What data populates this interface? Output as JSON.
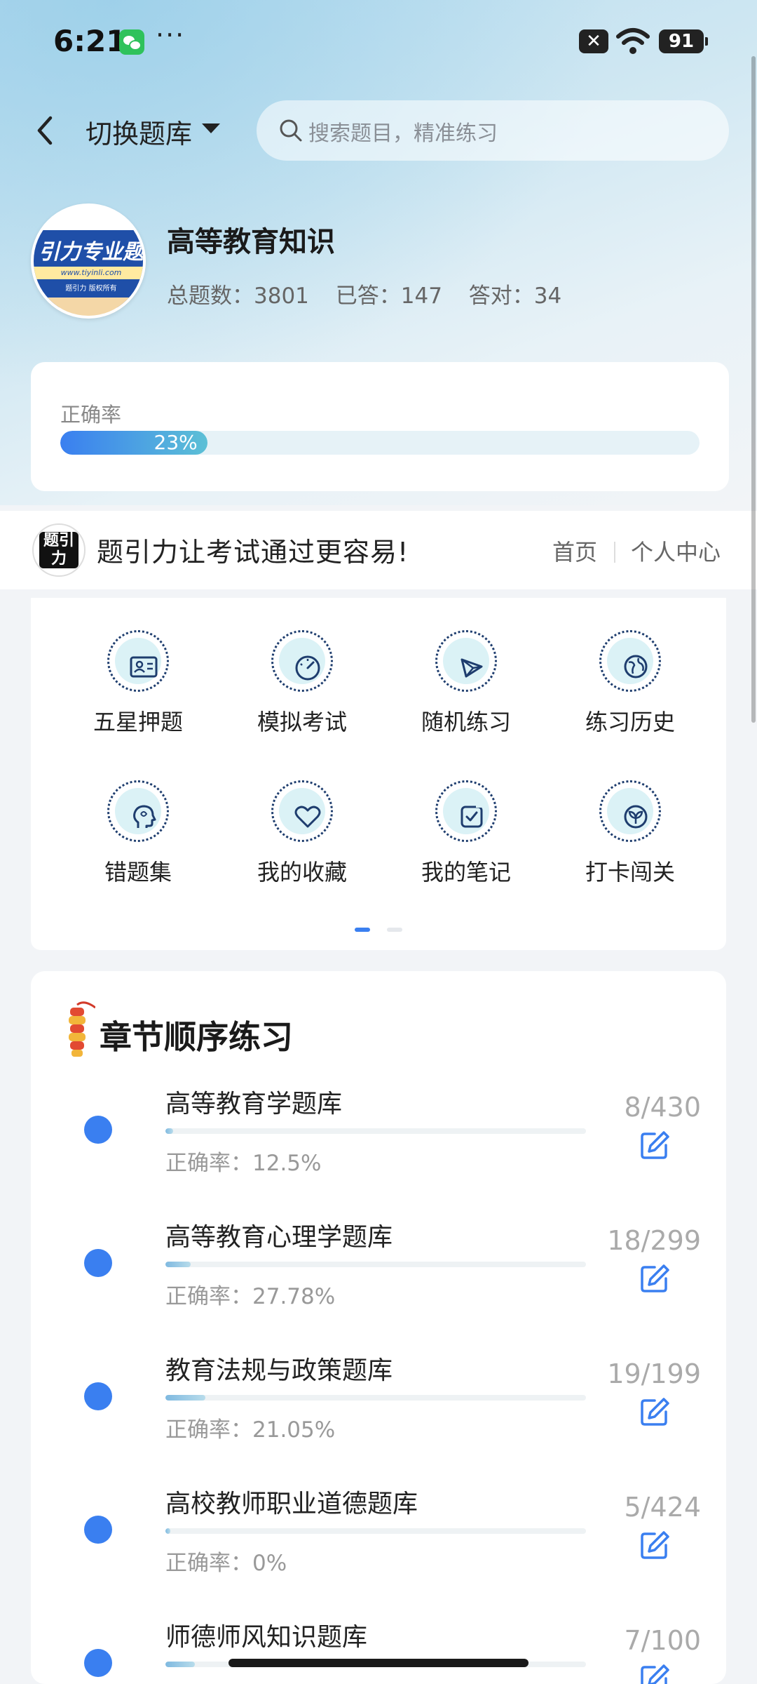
{
  "status_bar": {
    "time": "6:21",
    "dots": "···",
    "battery": "91"
  },
  "header": {
    "switch_label": "切换题库",
    "search_placeholder": "搜索题目，精准练习"
  },
  "profile": {
    "avatar_title": "引力专业题",
    "avatar_url": "www.tiyinli.com",
    "avatar_copyright": "题引力 版权所有",
    "bank_name": "高等教育知识",
    "stats": {
      "total": "总题数：3801",
      "answered": "已答：147",
      "correct": "答对：34"
    }
  },
  "accuracy": {
    "label": "正确率",
    "value_text": "23%",
    "value": 0.23
  },
  "banner": {
    "logo_text": "题引力",
    "slogan": "题引力让考试通过更容易!",
    "home": "首页",
    "user_center": "个人中心"
  },
  "grid": {
    "items": [
      {
        "label": "五星押题",
        "icon": "id-card-icon"
      },
      {
        "label": "模拟考试",
        "icon": "gauge-icon"
      },
      {
        "label": "随机练习",
        "icon": "shuffle-icon"
      },
      {
        "label": "练习历史",
        "icon": "globe-icon"
      },
      {
        "label": "错题集",
        "icon": "head-icon"
      },
      {
        "label": "我的收藏",
        "icon": "heart-icon"
      },
      {
        "label": "我的笔记",
        "icon": "note-check-icon"
      },
      {
        "label": "打卡闯关",
        "icon": "sprout-icon"
      }
    ],
    "page_count": 2,
    "active_page": 1
  },
  "chapters": {
    "title": "章节顺序练习",
    "items": [
      {
        "name": "高等教育学题库",
        "accuracy": "正确率：12.5%",
        "count": "8/430",
        "progress": 0.019
      },
      {
        "name": "高等教育心理学题库",
        "accuracy": "正确率：27.78%",
        "count": "18/299",
        "progress": 0.06
      },
      {
        "name": "教育法规与政策题库",
        "accuracy": "正确率：21.05%",
        "count": "19/199",
        "progress": 0.095
      },
      {
        "name": "高校教师职业道德题库",
        "accuracy": "正确率：0%",
        "count": "5/424",
        "progress": 0.012
      },
      {
        "name": "师德师风知识题库",
        "accuracy": "",
        "count": "7/100",
        "progress": 0.07
      }
    ]
  },
  "colors": {
    "accent": "#3a7ff0",
    "progress_light": "#5cc0d6",
    "icon_dark": "#1e3d6e",
    "icon_bg": "#dbf2f6"
  }
}
